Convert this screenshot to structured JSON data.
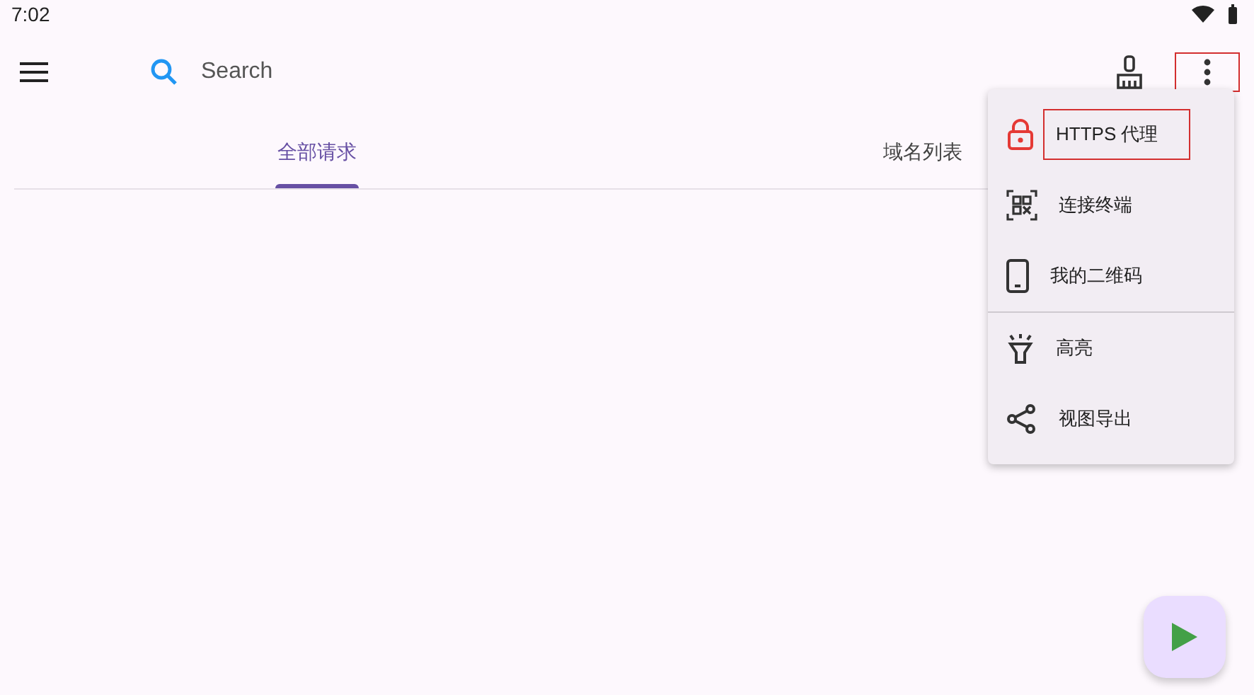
{
  "status_bar": {
    "time": "7:02"
  },
  "toolbar": {
    "search": {
      "placeholder": "Search"
    },
    "more_highlighted": true
  },
  "tabs": [
    {
      "label": "全部请求",
      "selected": true
    },
    {
      "label": "域名列表",
      "selected": false
    }
  ],
  "menu": {
    "items": [
      {
        "kind": "lock",
        "label": "HTTPS 代理",
        "highlighted": true,
        "divider_after": false
      },
      {
        "kind": "qr",
        "label": "连接终端",
        "highlighted": false,
        "divider_after": false
      },
      {
        "kind": "phone",
        "label": "我的二维码",
        "highlighted": false,
        "divider_after": true
      },
      {
        "kind": "light",
        "label": "高亮",
        "highlighted": false,
        "divider_after": false
      },
      {
        "kind": "share",
        "label": "视图导出",
        "highlighted": false,
        "divider_after": false
      }
    ]
  }
}
